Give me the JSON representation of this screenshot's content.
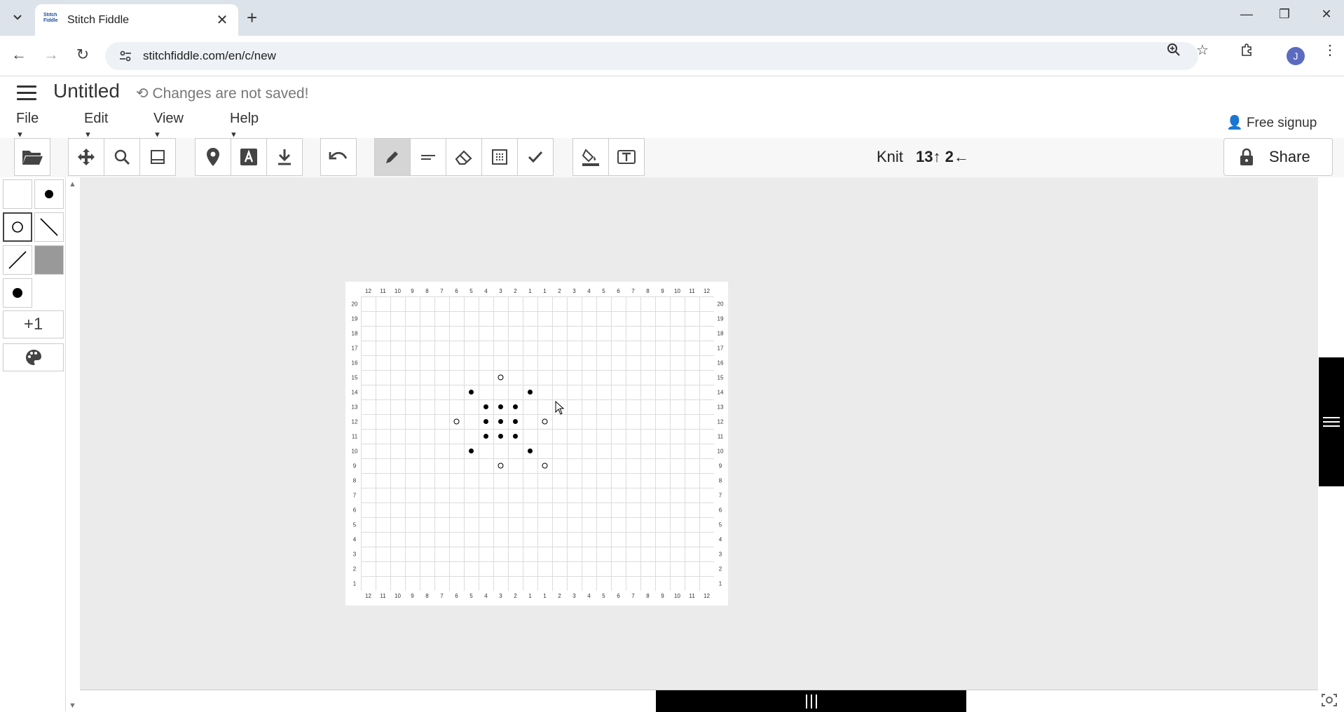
{
  "browser": {
    "tab_title": "Stitch Fiddle",
    "tab_favicon_text": "Stitch Fiddle",
    "url": "stitchfiddle.com/en/c/new",
    "profile_initial": "J"
  },
  "app": {
    "doc_title": "Untitled",
    "save_status": "Changes are not saved!",
    "menu": [
      {
        "label": "File"
      },
      {
        "label": "Edit"
      },
      {
        "label": "View"
      },
      {
        "label": "Help"
      }
    ],
    "signup_label": "Free signup",
    "knit_label": "Knit",
    "knit_position": "13↑ 2←",
    "share_label": "Share",
    "add_color_label": "+1"
  },
  "chart": {
    "columns_top": [
      "12",
      "11",
      "10",
      "9",
      "8",
      "7",
      "6",
      "5",
      "4",
      "3",
      "2",
      "1",
      "1",
      "2",
      "3",
      "4",
      "5",
      "6",
      "7",
      "8",
      "9",
      "10",
      "11",
      "12"
    ],
    "rows": [
      "20",
      "19",
      "18",
      "17",
      "16",
      "15",
      "14",
      "13",
      "12",
      "11",
      "10",
      "9",
      "8",
      "7",
      "6",
      "5",
      "4",
      "3",
      "2",
      "1"
    ],
    "stitches": [
      {
        "row": 15,
        "col": 9,
        "symbol": "open-circle"
      },
      {
        "row": 14,
        "col": 7,
        "symbol": "dot"
      },
      {
        "row": 14,
        "col": 11,
        "symbol": "dot"
      },
      {
        "row": 13,
        "col": 8,
        "symbol": "dot"
      },
      {
        "row": 13,
        "col": 9,
        "symbol": "dot"
      },
      {
        "row": 13,
        "col": 10,
        "symbol": "dot"
      },
      {
        "row": 12,
        "col": 6,
        "symbol": "open-circle"
      },
      {
        "row": 12,
        "col": 8,
        "symbol": "dot"
      },
      {
        "row": 12,
        "col": 9,
        "symbol": "dot"
      },
      {
        "row": 12,
        "col": 10,
        "symbol": "dot"
      },
      {
        "row": 12,
        "col": 12,
        "symbol": "open-circle"
      },
      {
        "row": 11,
        "col": 8,
        "symbol": "dot"
      },
      {
        "row": 11,
        "col": 9,
        "symbol": "dot"
      },
      {
        "row": 11,
        "col": 10,
        "symbol": "dot"
      },
      {
        "row": 10,
        "col": 7,
        "symbol": "dot"
      },
      {
        "row": 10,
        "col": 11,
        "symbol": "dot"
      },
      {
        "row": 9,
        "col": 9,
        "symbol": "open-circle"
      },
      {
        "row": 9,
        "col": 12,
        "symbol": "open-circle"
      }
    ]
  }
}
